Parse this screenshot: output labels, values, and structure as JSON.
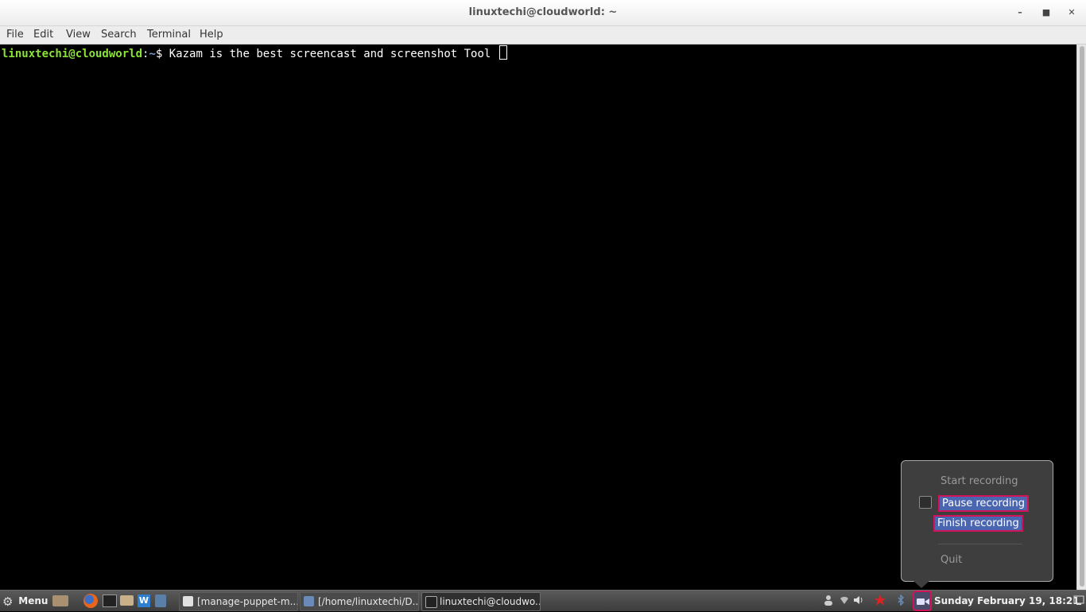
{
  "window": {
    "title": "linuxtechi@cloudworld: ~",
    "minimize_icon": "minimize-icon",
    "maximize_icon": "maximize-icon",
    "close_icon": "close-icon"
  },
  "menubar": {
    "items": [
      "File",
      "Edit",
      "View",
      "Search",
      "Terminal",
      "Help"
    ]
  },
  "terminal": {
    "prompt_user": "linuxtechi@cloudworld",
    "prompt_sep": ":",
    "prompt_path": "~",
    "prompt_symbol": "$",
    "command_text": " Kazam is the best screencast and screenshot Tool ",
    "colors": {
      "user": "#8ae234",
      "path": "#729fcf",
      "background": "#000000"
    }
  },
  "kazam_menu": {
    "start_recording": "Start recording",
    "pause_recording": "Pause recording",
    "finish_recording": "Finish recording",
    "quit": "Quit",
    "pause_checked": false,
    "highlight_color": "#d1145a"
  },
  "panel": {
    "menu_label": "Menu",
    "tasks": [
      {
        "label": "[manage-puppet-m...",
        "icon": "document-icon"
      },
      {
        "label": "[/home/linuxtechi/D...",
        "icon": "editor-icon"
      },
      {
        "label": "linuxtechi@cloudwo...",
        "icon": "terminal-icon",
        "active": true
      }
    ],
    "clock": "Sunday February 19, 18:21"
  }
}
